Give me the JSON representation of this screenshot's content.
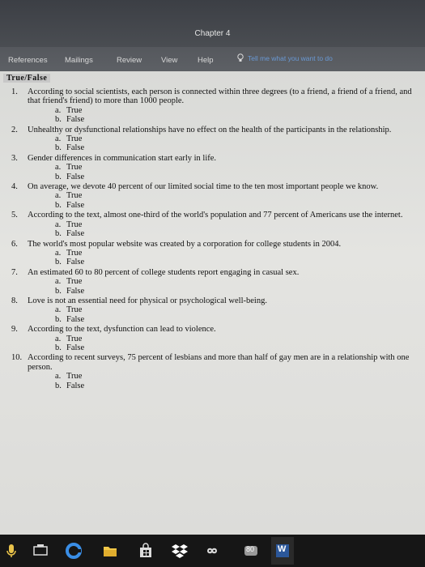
{
  "window": {
    "title": "Chapter 4"
  },
  "ribbon": {
    "tabs": [
      {
        "label": "References"
      },
      {
        "label": "Mailings"
      },
      {
        "label": "Review"
      },
      {
        "label": "View"
      },
      {
        "label": "Help"
      }
    ],
    "tell_me": "Tell me what you want to do"
  },
  "document": {
    "section": "True/False",
    "questions": [
      {
        "number": "1.",
        "text": "According to social scientists, each person is connected within three degrees (to a friend, a friend of a friend, and that friend's friend) to more than 1000 people.",
        "options": [
          {
            "letter": "a.",
            "label": "True"
          },
          {
            "letter": "b.",
            "label": "False"
          }
        ]
      },
      {
        "number": "2.",
        "text": "Unhealthy or dysfunctional relationships have no effect on the health of the participants in the relationship.",
        "options": [
          {
            "letter": "a.",
            "label": "True"
          },
          {
            "letter": "b.",
            "label": "False"
          }
        ]
      },
      {
        "number": "3.",
        "text": "Gender differences in communication start early in life.",
        "options": [
          {
            "letter": "a.",
            "label": "True"
          },
          {
            "letter": "b.",
            "label": "False"
          }
        ]
      },
      {
        "number": "4.",
        "text": "On average, we devote 40 percent of our limited social time to the ten most important people we know.",
        "options": [
          {
            "letter": "a.",
            "label": "True"
          },
          {
            "letter": "b.",
            "label": "False"
          }
        ]
      },
      {
        "number": "5.",
        "text": "According to the text, almost one-third of the world's population and 77 percent of Americans use the internet.",
        "options": [
          {
            "letter": "a.",
            "label": "True"
          },
          {
            "letter": "b.",
            "label": "False"
          }
        ]
      },
      {
        "number": "6.",
        "text": "The world's most popular website was created by a corporation for college students in 2004.",
        "options": [
          {
            "letter": "a.",
            "label": "True"
          },
          {
            "letter": "b.",
            "label": "False"
          }
        ]
      },
      {
        "number": "7.",
        "text": "An estimated 60 to 80 percent of college students report engaging in casual sex.",
        "options": [
          {
            "letter": "a.",
            "label": "True"
          },
          {
            "letter": "b.",
            "label": "False"
          }
        ]
      },
      {
        "number": "8.",
        "text": "Love is not an essential need for physical or psychological well-being.",
        "options": [
          {
            "letter": "a.",
            "label": "True"
          },
          {
            "letter": "b.",
            "label": "False"
          }
        ]
      },
      {
        "number": "9.",
        "text": "According to the text, dysfunction can lead to violence.",
        "options": [
          {
            "letter": "a.",
            "label": "True"
          },
          {
            "letter": "b.",
            "label": "False"
          }
        ]
      },
      {
        "number": "10.",
        "text": "According to recent surveys, 75 percent of lesbians and more than half of gay men are in a relationship with one person.",
        "options": [
          {
            "letter": "a.",
            "label": "True"
          },
          {
            "letter": "b.",
            "label": "False"
          }
        ]
      }
    ]
  },
  "taskbar": {
    "badge": "80",
    "word_label": "W",
    "icons": [
      "microphone-icon",
      "task-view-icon",
      "edge-icon",
      "file-explorer-icon",
      "store-icon",
      "dropbox-icon",
      "infinity-app-icon",
      "badge-app-icon",
      "word-icon"
    ]
  },
  "colors": {
    "page": "#e2e2df",
    "ribbon": "#5a5d62",
    "titlebar": "#43464b",
    "taskbar": "#161616",
    "edge": "#3a8ee6",
    "dropbox": "#ffffff"
  }
}
